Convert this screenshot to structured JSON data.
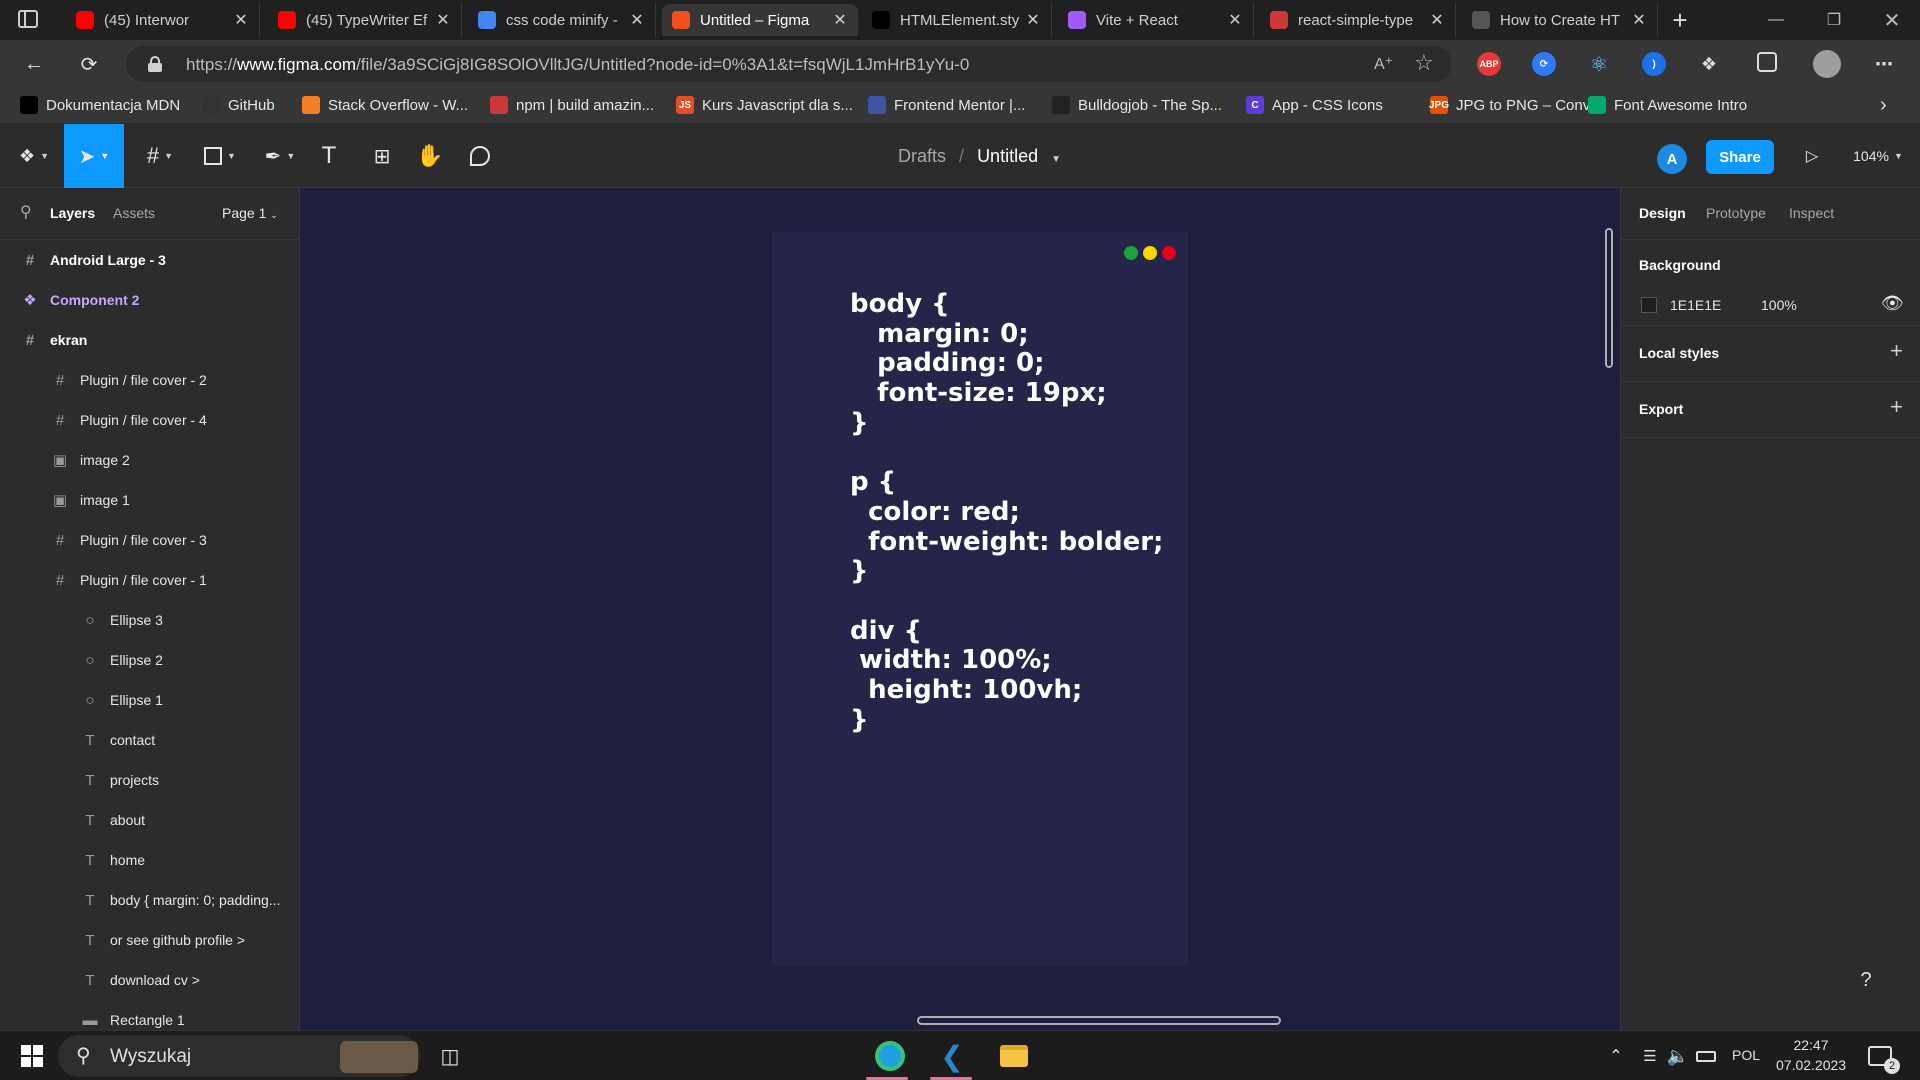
{
  "browser": {
    "tabs": [
      {
        "title": "(45) Interwor",
        "favicon": "youtube-icon",
        "color": "#ff0000"
      },
      {
        "title": "(45) TypeWriter Ef",
        "favicon": "youtube-icon",
        "color": "#ff0000"
      },
      {
        "title": "css code minify -",
        "favicon": "google-icon",
        "color": "#4285f4"
      },
      {
        "title": "Untitled – Figma",
        "favicon": "figma-icon",
        "color": "#f24e1e"
      },
      {
        "title": "HTMLElement.sty",
        "favicon": "mdn-icon",
        "color": "#000000"
      },
      {
        "title": "Vite + React",
        "favicon": "vite-icon",
        "color": "#a259ff"
      },
      {
        "title": "react-simple-type",
        "favicon": "npm-icon",
        "color": "#cb3837"
      },
      {
        "title": "How to Create HT",
        "favicon": "page-icon",
        "color": "#555555"
      }
    ],
    "url_prefix": "https://",
    "url_host": "www.figma.com",
    "url_path": "/file/3a9SCiGj8IG8SOlOVlltJG/Untitled?node-id=0%3A1&t=fsqWjL1JmHrB1yYu-0",
    "extensions": [
      {
        "label": "ABP",
        "color": "#e53935"
      }
    ],
    "bookmarks": [
      {
        "label": "Dokumentacja MDN",
        "icon": "mdn-icon",
        "color": "#000000"
      },
      {
        "label": "GitHub",
        "icon": "github-icon",
        "color": "#333333"
      },
      {
        "label": "Stack Overflow - W...",
        "icon": "stackoverflow-icon",
        "color": "#f48024"
      },
      {
        "label": "npm | build amazin...",
        "icon": "npm-icon",
        "color": "#cb3837"
      },
      {
        "label": "Kurs Javascript dla s...",
        "icon": "js-icon",
        "color": "#e44d26",
        "badge": "JS"
      },
      {
        "label": "Frontend Mentor |...",
        "icon": "frontend-mentor-icon",
        "color": "#3f54a3"
      },
      {
        "label": "Bulldogjob - The Sp...",
        "icon": "bulldog-icon",
        "color": "#222222"
      },
      {
        "label": "App - CSS Icons",
        "icon": "cssicons-icon",
        "color": "#5b3fd6",
        "badge": "C"
      },
      {
        "label": "JPG to PNG – Conv...",
        "icon": "jpgpng-icon",
        "color": "#e65100",
        "badge": "JPG"
      },
      {
        "label": "Font Awesome Intro",
        "icon": "w3-icon",
        "color": "#04aa6d"
      }
    ]
  },
  "figma": {
    "breadcrumb_drafts": "Drafts",
    "breadcrumb_sep": "/",
    "file_name": "Untitled",
    "avatar_letter": "A",
    "share_label": "Share",
    "zoom": "104%",
    "left_tabs": {
      "layers": "Layers",
      "assets": "Assets",
      "page": "Page 1"
    },
    "layers": [
      {
        "name": "Android Large - 3",
        "icon": "frame-icon",
        "level": 0,
        "kind": "top"
      },
      {
        "name": "Component 2",
        "icon": "component-icon",
        "level": 0,
        "kind": "comp"
      },
      {
        "name": "ekran",
        "icon": "frame-icon",
        "level": 0,
        "kind": "top"
      },
      {
        "name": "Plugin / file cover - 2",
        "icon": "frame-icon",
        "level": 1,
        "kind": ""
      },
      {
        "name": "Plugin / file cover - 4",
        "icon": "frame-icon",
        "level": 1,
        "kind": ""
      },
      {
        "name": "image 2",
        "icon": "image-icon",
        "level": 1,
        "kind": ""
      },
      {
        "name": "image 1",
        "icon": "image-icon",
        "level": 1,
        "kind": ""
      },
      {
        "name": "Plugin / file cover - 3",
        "icon": "frame-icon",
        "level": 1,
        "kind": ""
      },
      {
        "name": "Plugin / file cover - 1",
        "icon": "frame-icon",
        "level": 1,
        "kind": ""
      },
      {
        "name": "Ellipse 3",
        "icon": "ellipse-icon",
        "level": 2,
        "kind": ""
      },
      {
        "name": "Ellipse 2",
        "icon": "ellipse-icon",
        "level": 2,
        "kind": ""
      },
      {
        "name": "Ellipse 1",
        "icon": "ellipse-icon",
        "level": 2,
        "kind": ""
      },
      {
        "name": "contact",
        "icon": "text-icon",
        "level": 2,
        "kind": ""
      },
      {
        "name": "projects",
        "icon": "text-icon",
        "level": 2,
        "kind": ""
      },
      {
        "name": "about",
        "icon": "text-icon",
        "level": 2,
        "kind": ""
      },
      {
        "name": "home",
        "icon": "text-icon",
        "level": 2,
        "kind": ""
      },
      {
        "name": "body { margin: 0; padding...",
        "icon": "text-icon",
        "level": 2,
        "kind": ""
      },
      {
        "name": "or see github profile >",
        "icon": "text-icon",
        "level": 2,
        "kind": ""
      },
      {
        "name": "download cv >",
        "icon": "text-icon",
        "level": 2,
        "kind": ""
      },
      {
        "name": "Rectangle 1",
        "icon": "rectangle-icon",
        "level": 2,
        "kind": ""
      }
    ],
    "frame_code": "body {\n   margin: 0;\n   padding: 0;\n   font-size: 19px;\n}\n\np {\n  color: red;\n  font-weight: bolder;\n}\n\ndiv {\n width: 100%;\n  height: 100vh;\n}",
    "traffic_dots": [
      "#1aa33a",
      "#f5d800",
      "#e8001c"
    ],
    "right_tabs": {
      "design": "Design",
      "prototype": "Prototype",
      "inspect": "Inspect"
    },
    "background_label": "Background",
    "background_hex": "1E1E1E",
    "background_opacity": "100%",
    "local_styles_label": "Local styles",
    "export_label": "Export",
    "help_label": "?"
  },
  "taskbar": {
    "search_placeholder": "Wyszukaj",
    "language": "POL",
    "time": "22:47",
    "date": "07.02.2023",
    "notifications": "2"
  }
}
